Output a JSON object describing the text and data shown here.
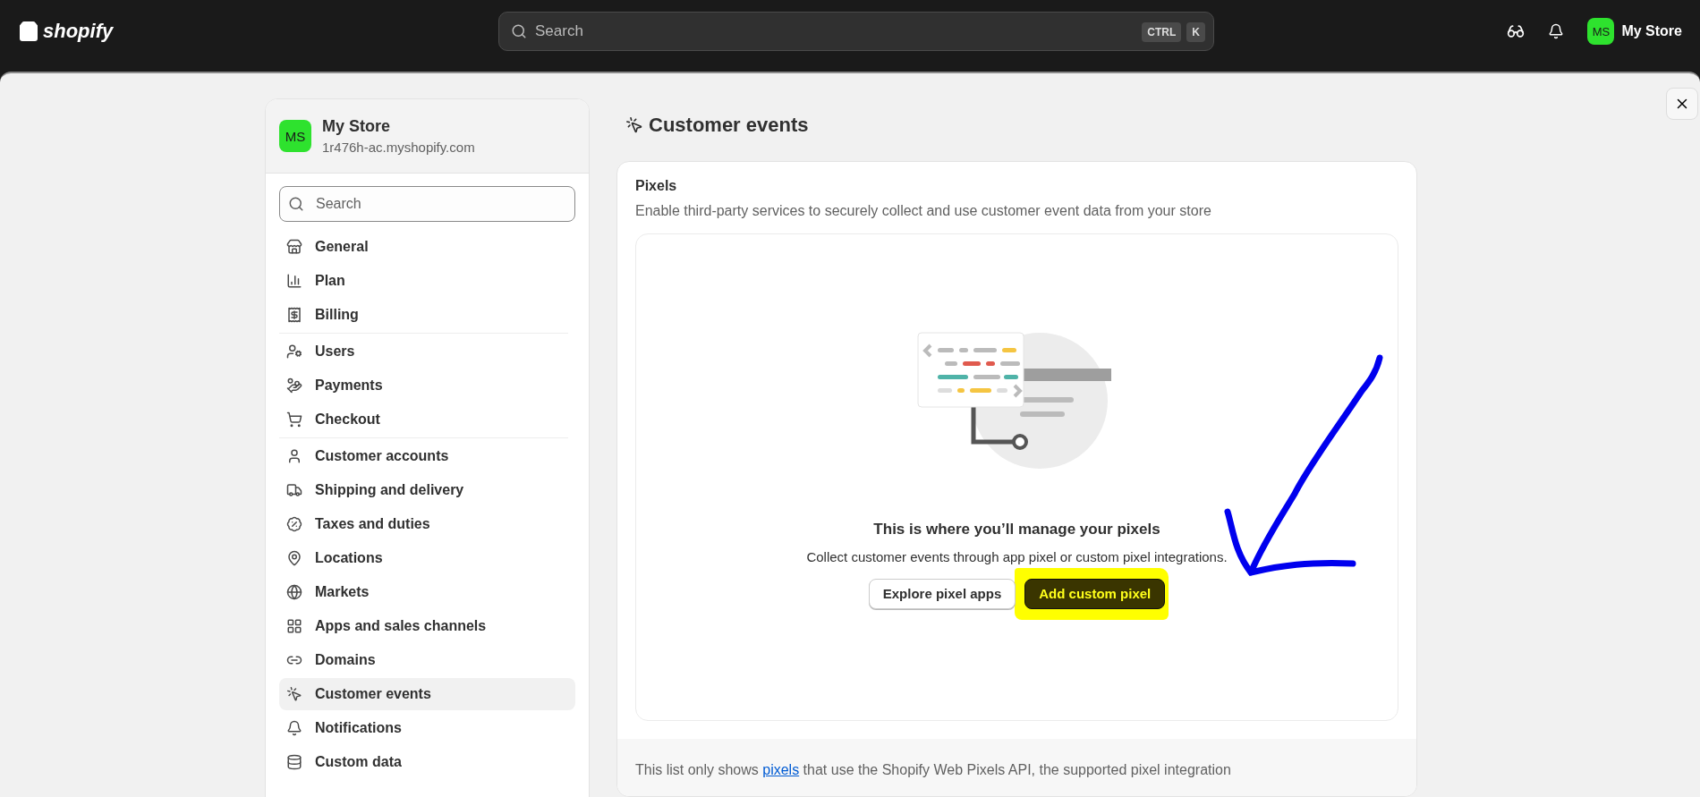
{
  "topbar": {
    "logo": "shopify",
    "search": {
      "placeholder": "Search",
      "keys": [
        "CTRL",
        "K"
      ]
    },
    "avatar": {
      "initials": "MS",
      "color": "#2ee22e"
    },
    "store_name": "My Store"
  },
  "sidebar": {
    "store": {
      "initials": "MS",
      "color": "#2ee22e",
      "name": "My Store",
      "domain": "1r476h-ac.myshopify.com"
    },
    "search": {
      "placeholder": "Search"
    },
    "sections": [
      {
        "items": [
          {
            "label": "General",
            "selected": false
          },
          {
            "label": "Plan",
            "selected": false
          },
          {
            "label": "Billing",
            "selected": false
          }
        ]
      },
      {
        "items": [
          {
            "label": "Users",
            "selected": false
          },
          {
            "label": "Payments",
            "selected": false
          },
          {
            "label": "Checkout",
            "selected": false
          }
        ]
      },
      {
        "items": [
          {
            "label": "Customer accounts",
            "selected": false
          },
          {
            "label": "Shipping and delivery",
            "selected": false
          },
          {
            "label": "Taxes and duties",
            "selected": false
          },
          {
            "label": "Locations",
            "selected": false
          },
          {
            "label": "Markets",
            "selected": false
          },
          {
            "label": "Apps and sales channels",
            "selected": false
          },
          {
            "label": "Domains",
            "selected": false
          },
          {
            "label": "Customer events",
            "selected": true
          },
          {
            "label": "Notifications",
            "selected": false
          },
          {
            "label": "Custom data",
            "selected": false
          }
        ]
      }
    ]
  },
  "page": {
    "title": "Customer events",
    "card": {
      "title": "Pixels",
      "description": "Enable third-party services to securely collect and use customer event data from your store",
      "empty_state": {
        "heading": "This is where you’ll manage your pixels",
        "text": "Collect customer events through app pixel or custom pixel integrations.",
        "buttons": [
          {
            "label": "Explore pixel apps",
            "kind": "secondary"
          },
          {
            "label": "Add custom pixel",
            "kind": "primary"
          }
        ]
      },
      "footer": {
        "before": "This list only shows ",
        "link": "pixels",
        "after": " that use the Shopify Web Pixels API, the supported pixel integration"
      }
    }
  }
}
